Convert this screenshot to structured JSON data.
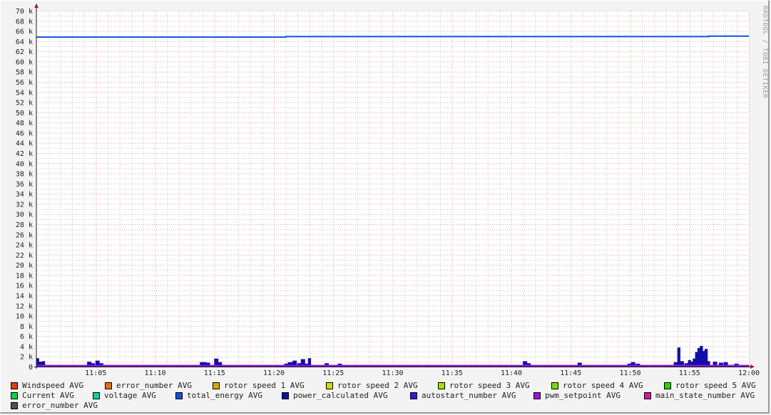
{
  "watermark": "RRDTOOL / TOBI OETIKER",
  "chart_data": {
    "type": "line",
    "title": "",
    "xlabel": "",
    "ylabel": "",
    "x_unit": "minutes after 11:00",
    "xlim": [
      0,
      60
    ],
    "ylim": [
      0,
      70
    ],
    "y_unit": "k",
    "y_ticks": [
      0,
      2,
      4,
      6,
      8,
      10,
      12,
      14,
      16,
      18,
      20,
      22,
      24,
      26,
      28,
      30,
      32,
      34,
      36,
      38,
      40,
      42,
      44,
      46,
      48,
      50,
      52,
      54,
      56,
      58,
      60,
      62,
      64,
      66,
      68,
      70
    ],
    "x_ticks": [
      {
        "min": 5,
        "label": "11:05"
      },
      {
        "min": 10,
        "label": "11:10"
      },
      {
        "min": 15,
        "label": "11:15"
      },
      {
        "min": 20,
        "label": "11:20"
      },
      {
        "min": 25,
        "label": "11:25"
      },
      {
        "min": 30,
        "label": "11:30"
      },
      {
        "min": 35,
        "label": "11:35"
      },
      {
        "min": 40,
        "label": "11:40"
      },
      {
        "min": 45,
        "label": "11:45"
      },
      {
        "min": 50,
        "label": "11:50"
      },
      {
        "min": 55,
        "label": "11:55"
      },
      {
        "min": 60,
        "label": "12:00"
      }
    ],
    "grid": true,
    "legend_position": "bottom",
    "series": [
      {
        "name": "Windspeed AVG",
        "color": "#e0400c"
      },
      {
        "name": "error_number AVG",
        "color": "#e07010"
      },
      {
        "name": "rotor speed 1 AVG",
        "color": "#d8a800"
      },
      {
        "name": "rotor speed 2 AVG",
        "color": "#d8d800"
      },
      {
        "name": "rotor speed 3 AVG",
        "color": "#a8e000"
      },
      {
        "name": "rotor speed 4 AVG",
        "color": "#70e000"
      },
      {
        "name": "rotor speed 5 AVG",
        "color": "#30d000"
      },
      {
        "name": "Current AVG",
        "color": "#10d040"
      },
      {
        "name": "voltage AVG",
        "color": "#10d0a0"
      },
      {
        "name": "total_energy AVG",
        "color": "#1050e0",
        "steps": [
          [
            0,
            64.8
          ],
          [
            21,
            64.9
          ],
          [
            56.6,
            65.0
          ],
          [
            60,
            65.0
          ]
        ]
      },
      {
        "name": "power_calculated AVG",
        "color": "#1010a8",
        "baseline": 0.25,
        "bursts": [
          [
            0.0,
            0.2,
            1.6
          ],
          [
            0.2,
            0.5,
            0.9
          ],
          [
            0.5,
            0.7,
            1.0
          ],
          [
            4.3,
            4.6,
            0.9
          ],
          [
            4.6,
            4.9,
            0.6
          ],
          [
            5.0,
            5.3,
            1.1
          ],
          [
            5.3,
            5.6,
            0.6
          ],
          [
            13.8,
            14.3,
            0.8
          ],
          [
            14.3,
            14.6,
            0.7
          ],
          [
            15.0,
            15.3,
            1.5
          ],
          [
            15.3,
            15.6,
            0.8
          ],
          [
            20.9,
            21.2,
            0.5
          ],
          [
            21.2,
            21.6,
            0.8
          ],
          [
            21.6,
            21.9,
            1.1
          ],
          [
            22.0,
            22.3,
            0.6
          ],
          [
            22.3,
            22.6,
            1.4
          ],
          [
            22.6,
            22.9,
            0.5
          ],
          [
            22.9,
            23.1,
            1.6
          ],
          [
            24.3,
            24.6,
            0.6
          ],
          [
            25.4,
            25.7,
            0.5
          ],
          [
            41.0,
            41.3,
            1.0
          ],
          [
            41.3,
            41.6,
            0.6
          ],
          [
            45.6,
            45.9,
            0.7
          ],
          [
            49.8,
            50.1,
            0.5
          ],
          [
            50.1,
            50.4,
            0.8
          ],
          [
            50.5,
            50.8,
            0.5
          ],
          [
            53.7,
            54.0,
            0.8
          ],
          [
            54.0,
            54.2,
            3.7
          ],
          [
            54.2,
            54.5,
            1.0
          ],
          [
            54.6,
            54.9,
            0.6
          ],
          [
            54.9,
            55.1,
            1.2
          ],
          [
            55.1,
            55.3,
            0.9
          ],
          [
            55.3,
            55.5,
            1.5
          ],
          [
            55.5,
            55.7,
            2.8
          ],
          [
            55.7,
            55.9,
            3.6
          ],
          [
            55.9,
            56.1,
            4.0
          ],
          [
            56.1,
            56.3,
            3.0
          ],
          [
            56.3,
            56.5,
            3.4
          ],
          [
            56.5,
            56.7,
            1.0
          ],
          [
            57.0,
            57.3,
            0.9
          ],
          [
            57.5,
            57.8,
            0.7
          ],
          [
            57.9,
            58.2,
            0.8
          ],
          [
            58.8,
            59.1,
            0.5
          ]
        ]
      },
      {
        "name": "autostart_number AVG",
        "color": "#4010e0"
      },
      {
        "name": "pwm_setpoint AVG",
        "color": "#a010e0",
        "constant": 0.2
      },
      {
        "name": "main_state_number AVG",
        "color": "#e010a0"
      },
      {
        "name": "error_number AVG",
        "color": "#505050"
      }
    ]
  }
}
